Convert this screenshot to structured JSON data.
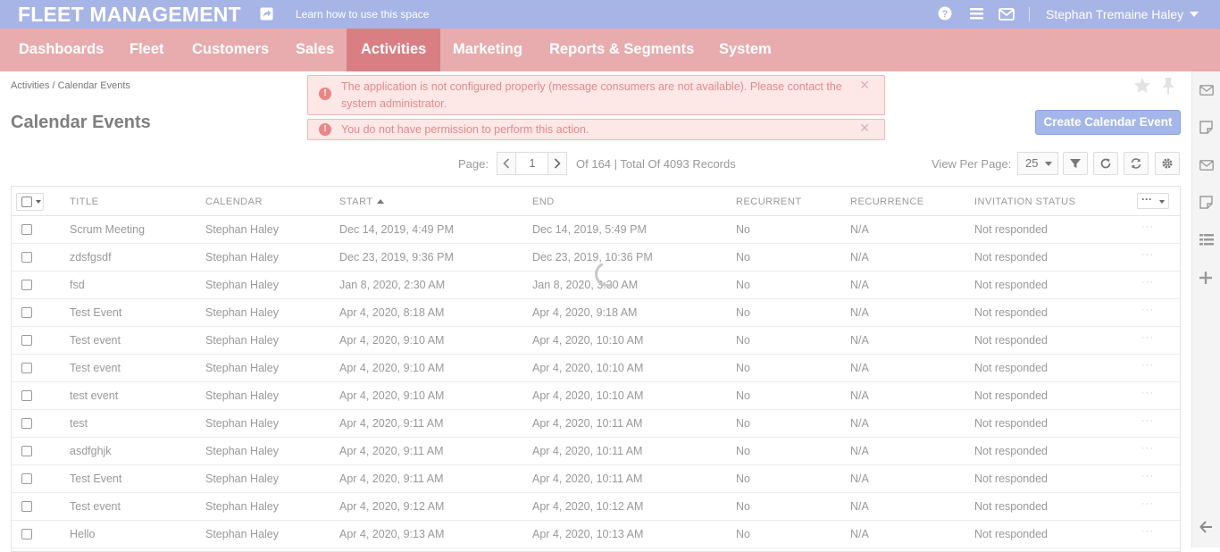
{
  "app": {
    "title": "FLEET MANAGEMENT",
    "learn_link": "Learn how to use this space",
    "user_name": "Stephan Tremaine Haley"
  },
  "nav": {
    "items": [
      {
        "label": "Dashboards",
        "active": false
      },
      {
        "label": "Fleet",
        "active": false
      },
      {
        "label": "Customers",
        "active": false
      },
      {
        "label": "Sales",
        "active": false
      },
      {
        "label": "Activities",
        "active": true
      },
      {
        "label": "Marketing",
        "active": false
      },
      {
        "label": "Reports & Segments",
        "active": false
      },
      {
        "label": "System",
        "active": false
      }
    ]
  },
  "breadcrumb": "Activities / Calendar Events",
  "alerts": [
    {
      "text": "The application is not configured properly (message consumers are not available). Please contact the system administrator."
    },
    {
      "text": "You do not have permission to perform this action."
    }
  ],
  "page": {
    "title": "Calendar Events",
    "create_button": "Create Calendar Event"
  },
  "pager": {
    "label": "Page:",
    "current": "1",
    "info": "Of 164 | Total Of 4093 Records",
    "view_per_page_label": "View Per Page:",
    "per_page": "25"
  },
  "grid": {
    "columns": [
      "TITLE",
      "CALENDAR",
      "START",
      "END",
      "RECURRENT",
      "RECURRENCE",
      "INVITATION STATUS"
    ],
    "sorted_column": "START",
    "sort_direction": "ascending",
    "rows": [
      [
        "Scrum Meeting",
        "Stephan Haley",
        "Dec 14, 2019, 4:49 PM",
        "Dec 14, 2019, 5:49 PM",
        "No",
        "N/A",
        "Not responded"
      ],
      [
        "zdsfgsdf",
        "Stephan Haley",
        "Dec 23, 2019, 9:36 PM",
        "Dec 23, 2019, 10:36 PM",
        "No",
        "N/A",
        "Not responded"
      ],
      [
        "fsd",
        "Stephan Haley",
        "Jan 8, 2020, 2:30 AM",
        "Jan 8, 2020, 3:30 AM",
        "No",
        "N/A",
        "Not responded"
      ],
      [
        "Test Event",
        "Stephan Haley",
        "Apr 4, 2020, 8:18 AM",
        "Apr 4, 2020, 9:18 AM",
        "No",
        "N/A",
        "Not responded"
      ],
      [
        "Test event",
        "Stephan Haley",
        "Apr 4, 2020, 9:10 AM",
        "Apr 4, 2020, 10:10 AM",
        "No",
        "N/A",
        "Not responded"
      ],
      [
        "Test event",
        "Stephan Haley",
        "Apr 4, 2020, 9:10 AM",
        "Apr 4, 2020, 10:10 AM",
        "No",
        "N/A",
        "Not responded"
      ],
      [
        "test event",
        "Stephan Haley",
        "Apr 4, 2020, 9:10 AM",
        "Apr 4, 2020, 10:10 AM",
        "No",
        "N/A",
        "Not responded"
      ],
      [
        "test",
        "Stephan Haley",
        "Apr 4, 2020, 9:11 AM",
        "Apr 4, 2020, 10:11 AM",
        "No",
        "N/A",
        "Not responded"
      ],
      [
        "asdfghjk",
        "Stephan Haley",
        "Apr 4, 2020, 9:11 AM",
        "Apr 4, 2020, 10:11 AM",
        "No",
        "N/A",
        "Not responded"
      ],
      [
        "Test Event",
        "Stephan Haley",
        "Apr 4, 2020, 9:11 AM",
        "Apr 4, 2020, 10:11 AM",
        "No",
        "N/A",
        "Not responded"
      ],
      [
        "Test event",
        "Stephan Haley",
        "Apr 4, 2020, 9:12 AM",
        "Apr 4, 2020, 10:12 AM",
        "No",
        "N/A",
        "Not responded"
      ],
      [
        "Hello",
        "Stephan Haley",
        "Apr 4, 2020, 9:13 AM",
        "Apr 4, 2020, 10:13 AM",
        "No",
        "N/A",
        "Not responded"
      ]
    ]
  },
  "colors": {
    "topbar": "#a7b4e6",
    "navbar": "#e8acae",
    "nav_active": "#d97f83",
    "alert_bg": "#fde7e7",
    "create_button": "#a4b6ea"
  },
  "icons": {
    "top": [
      "share-icon",
      "help-icon",
      "menu-icon",
      "mail-icon",
      "chevron-down-icon"
    ],
    "sidebar": [
      "mail-icon",
      "note-icon",
      "mail-icon",
      "note-icon",
      "list-icon",
      "plus-icon",
      "arrow-left-icon"
    ]
  }
}
